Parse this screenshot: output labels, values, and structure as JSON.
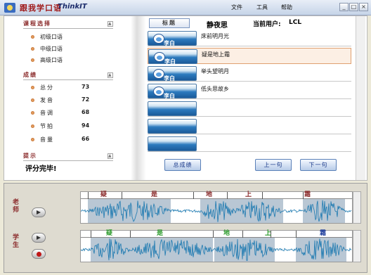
{
  "title": {
    "app": "跟我学口语",
    "brand": "ThinkIT"
  },
  "menu": {
    "file": "文件",
    "tools": "工具",
    "help": "帮助"
  },
  "window_buttons": {
    "min": "_",
    "max": "□",
    "close": "×"
  },
  "left": {
    "course_header": "课程选择",
    "courses": [
      "初级口语",
      "中级口语",
      "高级口语"
    ],
    "score_header": "成绩",
    "scores": [
      {
        "label": "总分",
        "value": "73"
      },
      {
        "label": "发音",
        "value": "72"
      },
      {
        "label": "音调",
        "value": "68"
      },
      {
        "label": "节拍",
        "value": "94"
      },
      {
        "label": "音量",
        "value": "66"
      }
    ],
    "hint_header": "提示",
    "hint_text": "评分完毕!"
  },
  "right": {
    "tab_label": "标题",
    "poem_title": "静夜思",
    "user_label": "当前用户:",
    "user_name": "LCL",
    "rows": [
      {
        "name": "李白",
        "text": "床前明月光",
        "selected": false
      },
      {
        "name": "李白",
        "text": "疑是地上霜",
        "selected": true
      },
      {
        "name": "李白",
        "text": "举头望明月",
        "selected": false
      },
      {
        "name": "李白",
        "text": "低头思故乡",
        "selected": false
      },
      {
        "name": "",
        "text": "",
        "selected": false
      },
      {
        "name": "",
        "text": "",
        "selected": false
      },
      {
        "name": "",
        "text": "",
        "selected": false
      }
    ],
    "total_score_btn": "总成绩",
    "prev_btn": "上一句",
    "next_btn": "下一句"
  },
  "audio": {
    "teacher_label": "老师",
    "student_label": "学生",
    "teacher_words": [
      "疑",
      "是",
      "地",
      "上",
      "霜"
    ],
    "student_words": [
      "疑",
      "是",
      "地",
      "上",
      "霜"
    ],
    "colors": {
      "wave": "#1a78b0",
      "segment": "#b9c7d4",
      "word_red": "#8a2a2a",
      "word_green": "#2a9a2a",
      "word_blue": "#1a3a9a"
    }
  }
}
